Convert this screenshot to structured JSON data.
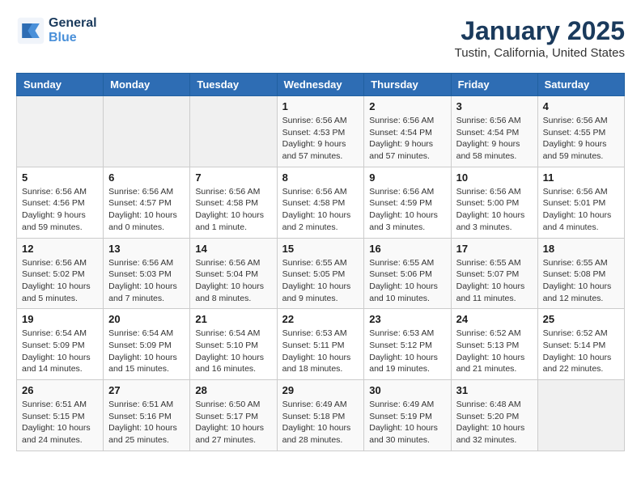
{
  "header": {
    "logo_line1": "General",
    "logo_line2": "Blue",
    "month": "January 2025",
    "location": "Tustin, California, United States"
  },
  "weekdays": [
    "Sunday",
    "Monday",
    "Tuesday",
    "Wednesday",
    "Thursday",
    "Friday",
    "Saturday"
  ],
  "weeks": [
    [
      {
        "day": "",
        "info": ""
      },
      {
        "day": "",
        "info": ""
      },
      {
        "day": "",
        "info": ""
      },
      {
        "day": "1",
        "info": "Sunrise: 6:56 AM\nSunset: 4:53 PM\nDaylight: 9 hours\nand 57 minutes."
      },
      {
        "day": "2",
        "info": "Sunrise: 6:56 AM\nSunset: 4:54 PM\nDaylight: 9 hours\nand 57 minutes."
      },
      {
        "day": "3",
        "info": "Sunrise: 6:56 AM\nSunset: 4:54 PM\nDaylight: 9 hours\nand 58 minutes."
      },
      {
        "day": "4",
        "info": "Sunrise: 6:56 AM\nSunset: 4:55 PM\nDaylight: 9 hours\nand 59 minutes."
      }
    ],
    [
      {
        "day": "5",
        "info": "Sunrise: 6:56 AM\nSunset: 4:56 PM\nDaylight: 9 hours\nand 59 minutes."
      },
      {
        "day": "6",
        "info": "Sunrise: 6:56 AM\nSunset: 4:57 PM\nDaylight: 10 hours\nand 0 minutes."
      },
      {
        "day": "7",
        "info": "Sunrise: 6:56 AM\nSunset: 4:58 PM\nDaylight: 10 hours\nand 1 minute."
      },
      {
        "day": "8",
        "info": "Sunrise: 6:56 AM\nSunset: 4:58 PM\nDaylight: 10 hours\nand 2 minutes."
      },
      {
        "day": "9",
        "info": "Sunrise: 6:56 AM\nSunset: 4:59 PM\nDaylight: 10 hours\nand 3 minutes."
      },
      {
        "day": "10",
        "info": "Sunrise: 6:56 AM\nSunset: 5:00 PM\nDaylight: 10 hours\nand 3 minutes."
      },
      {
        "day": "11",
        "info": "Sunrise: 6:56 AM\nSunset: 5:01 PM\nDaylight: 10 hours\nand 4 minutes."
      }
    ],
    [
      {
        "day": "12",
        "info": "Sunrise: 6:56 AM\nSunset: 5:02 PM\nDaylight: 10 hours\nand 5 minutes."
      },
      {
        "day": "13",
        "info": "Sunrise: 6:56 AM\nSunset: 5:03 PM\nDaylight: 10 hours\nand 7 minutes."
      },
      {
        "day": "14",
        "info": "Sunrise: 6:56 AM\nSunset: 5:04 PM\nDaylight: 10 hours\nand 8 minutes."
      },
      {
        "day": "15",
        "info": "Sunrise: 6:55 AM\nSunset: 5:05 PM\nDaylight: 10 hours\nand 9 minutes."
      },
      {
        "day": "16",
        "info": "Sunrise: 6:55 AM\nSunset: 5:06 PM\nDaylight: 10 hours\nand 10 minutes."
      },
      {
        "day": "17",
        "info": "Sunrise: 6:55 AM\nSunset: 5:07 PM\nDaylight: 10 hours\nand 11 minutes."
      },
      {
        "day": "18",
        "info": "Sunrise: 6:55 AM\nSunset: 5:08 PM\nDaylight: 10 hours\nand 12 minutes."
      }
    ],
    [
      {
        "day": "19",
        "info": "Sunrise: 6:54 AM\nSunset: 5:09 PM\nDaylight: 10 hours\nand 14 minutes."
      },
      {
        "day": "20",
        "info": "Sunrise: 6:54 AM\nSunset: 5:09 PM\nDaylight: 10 hours\nand 15 minutes."
      },
      {
        "day": "21",
        "info": "Sunrise: 6:54 AM\nSunset: 5:10 PM\nDaylight: 10 hours\nand 16 minutes."
      },
      {
        "day": "22",
        "info": "Sunrise: 6:53 AM\nSunset: 5:11 PM\nDaylight: 10 hours\nand 18 minutes."
      },
      {
        "day": "23",
        "info": "Sunrise: 6:53 AM\nSunset: 5:12 PM\nDaylight: 10 hours\nand 19 minutes."
      },
      {
        "day": "24",
        "info": "Sunrise: 6:52 AM\nSunset: 5:13 PM\nDaylight: 10 hours\nand 21 minutes."
      },
      {
        "day": "25",
        "info": "Sunrise: 6:52 AM\nSunset: 5:14 PM\nDaylight: 10 hours\nand 22 minutes."
      }
    ],
    [
      {
        "day": "26",
        "info": "Sunrise: 6:51 AM\nSunset: 5:15 PM\nDaylight: 10 hours\nand 24 minutes."
      },
      {
        "day": "27",
        "info": "Sunrise: 6:51 AM\nSunset: 5:16 PM\nDaylight: 10 hours\nand 25 minutes."
      },
      {
        "day": "28",
        "info": "Sunrise: 6:50 AM\nSunset: 5:17 PM\nDaylight: 10 hours\nand 27 minutes."
      },
      {
        "day": "29",
        "info": "Sunrise: 6:49 AM\nSunset: 5:18 PM\nDaylight: 10 hours\nand 28 minutes."
      },
      {
        "day": "30",
        "info": "Sunrise: 6:49 AM\nSunset: 5:19 PM\nDaylight: 10 hours\nand 30 minutes."
      },
      {
        "day": "31",
        "info": "Sunrise: 6:48 AM\nSunset: 5:20 PM\nDaylight: 10 hours\nand 32 minutes."
      },
      {
        "day": "",
        "info": ""
      }
    ]
  ]
}
